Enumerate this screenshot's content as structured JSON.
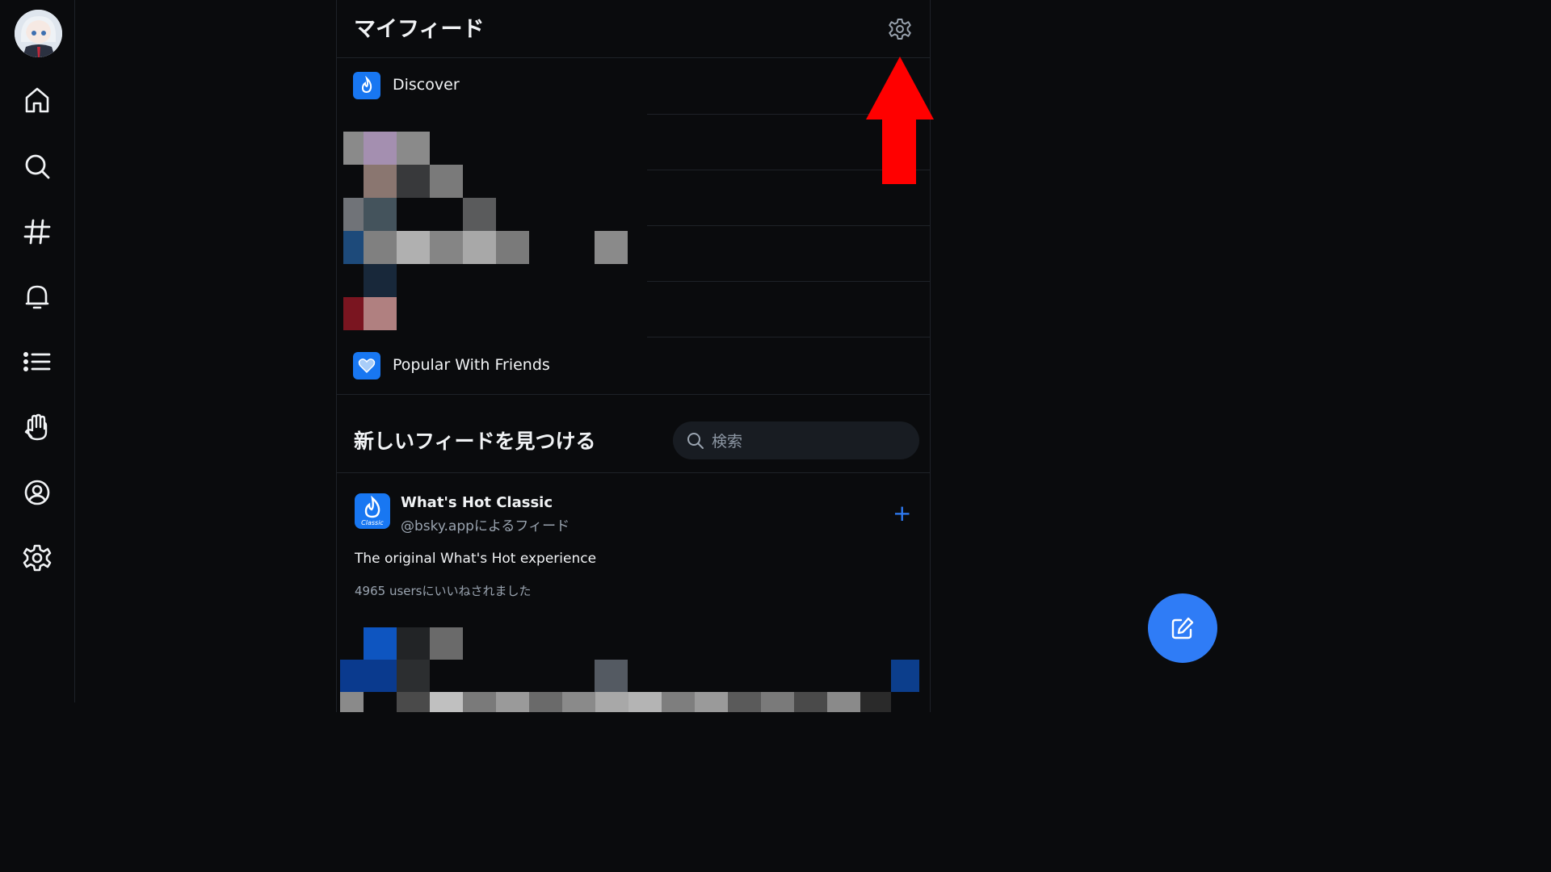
{
  "header": {
    "title": "マイフィード"
  },
  "my_feeds": [
    {
      "label": "Discover"
    },
    {
      "label": "Popular With Friends"
    }
  ],
  "discover": {
    "title": "新しいフィードを見つける",
    "search_placeholder": "検索"
  },
  "card": {
    "title": "What's Hot Classic",
    "subtitle": "@bsky.appによるフィード",
    "icon_label": "Classic",
    "add_label": "+",
    "description": "The original What's Hot experience",
    "likes": "4965 usersにいいねされました"
  },
  "colors": {
    "accent": "#2f7cf6",
    "feed_icon": "#1877f2",
    "annotation_arrow": "#ff0000"
  }
}
